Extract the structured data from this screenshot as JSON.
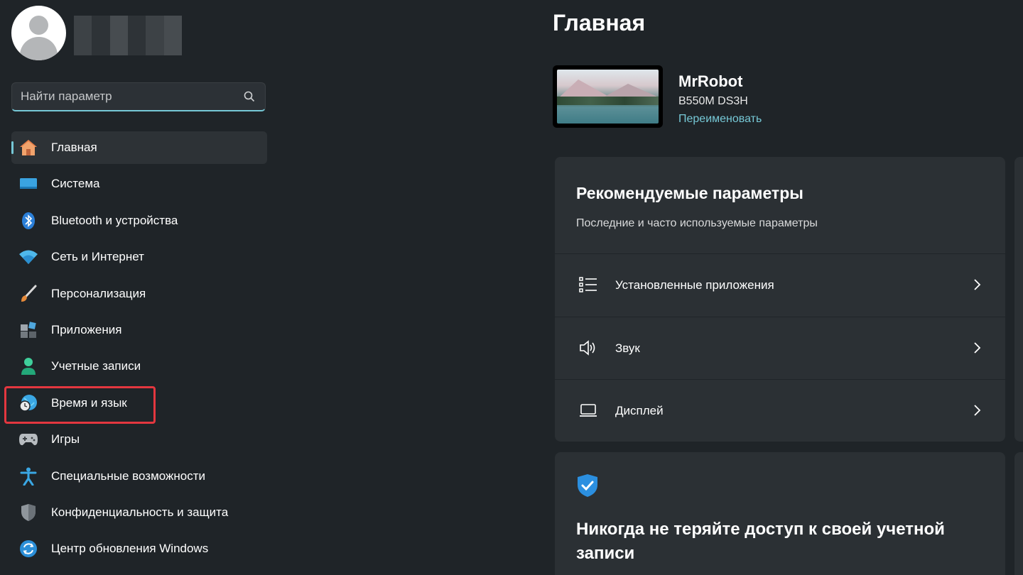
{
  "sidebar": {
    "search": {
      "placeholder": "Найти параметр",
      "value": ""
    },
    "items": [
      {
        "label": "Главная",
        "icon": "home-icon",
        "active": true
      },
      {
        "label": "Система",
        "icon": "monitor-icon"
      },
      {
        "label": "Bluetooth и устройства",
        "icon": "bluetooth-icon"
      },
      {
        "label": "Сеть и Интернет",
        "icon": "wifi-icon"
      },
      {
        "label": "Персонализация",
        "icon": "brush-icon"
      },
      {
        "label": "Приложения",
        "icon": "apps-icon"
      },
      {
        "label": "Учетные записи",
        "icon": "user-icon"
      },
      {
        "label": "Время и язык",
        "icon": "globe-clock-icon",
        "highlighted": true
      },
      {
        "label": "Игры",
        "icon": "gamepad-icon"
      },
      {
        "label": "Специальные возможности",
        "icon": "accessibility-icon"
      },
      {
        "label": "Конфиденциальность и защита",
        "icon": "shield-icon"
      },
      {
        "label": "Центр обновления Windows",
        "icon": "update-icon"
      }
    ]
  },
  "main": {
    "title": "Главная",
    "device": {
      "name": "MrRobot",
      "model": "B550M DS3H",
      "rename_label": "Переименовать"
    },
    "recommended": {
      "title": "Рекомендуемые параметры",
      "subtitle": "Последние и часто используемые параметры",
      "rows": [
        {
          "label": "Установленные приложения",
          "icon": "list-icon"
        },
        {
          "label": "Звук",
          "icon": "speaker-icon"
        },
        {
          "label": "Дисплей",
          "icon": "laptop-icon"
        }
      ]
    },
    "account_card": {
      "title": "Никогда не теряйте доступ к своей учетной записи",
      "icon": "shield-check-icon"
    }
  },
  "colors": {
    "background": "#1f2428",
    "card": "#2b3034",
    "accent": "#76c8d6",
    "highlight": "#e3373f"
  }
}
